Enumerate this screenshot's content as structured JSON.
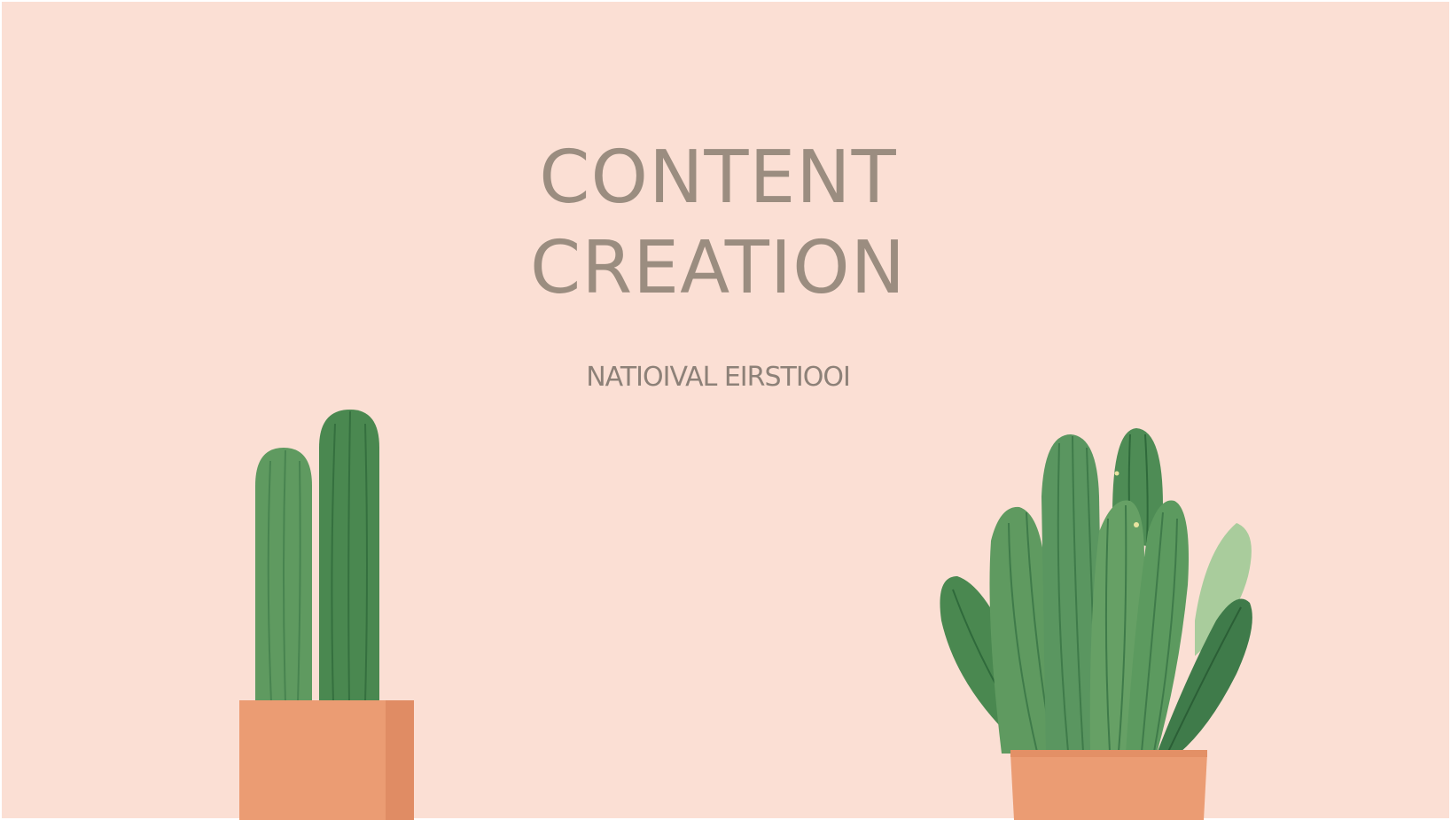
{
  "title": {
    "line1": "CONTENT",
    "line2": "CREATION"
  },
  "subtitle": "NATIOIVAL EIRSTIOOI",
  "illustrations": {
    "left": "tall-cactus-icon",
    "right": "succulent-icon"
  },
  "colors": {
    "background": "#fbdfd4",
    "title": "#9b8d80",
    "pot": "#e99a72",
    "cactus_dark": "#3f7b4a",
    "cactus_mid": "#5f9a60",
    "leaf_light": "#a9cc9c"
  }
}
